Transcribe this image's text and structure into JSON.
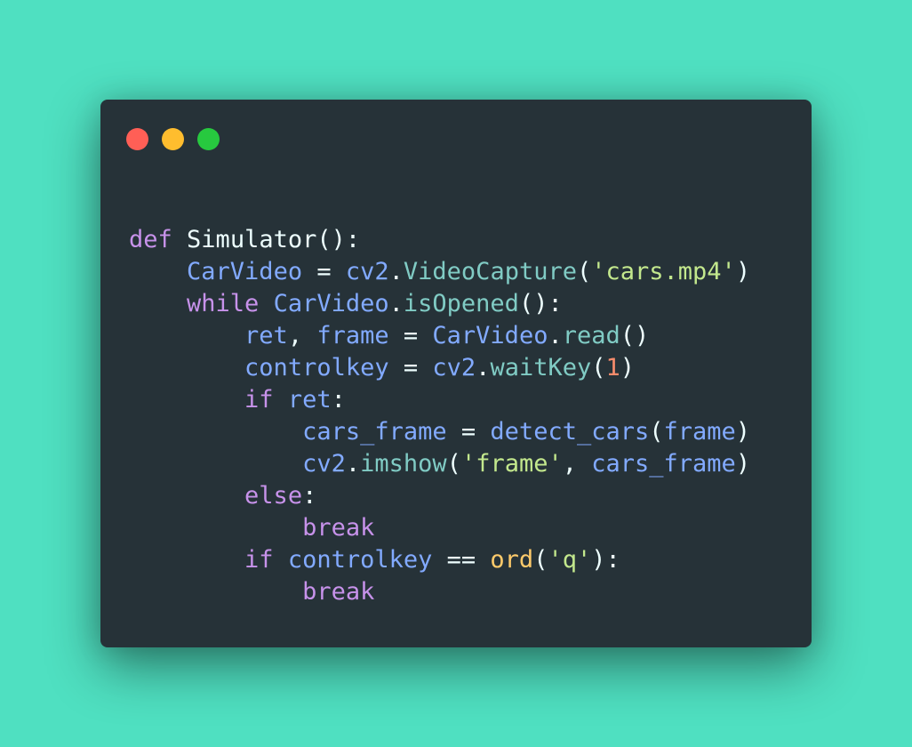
{
  "window_controls": [
    {
      "name": "close-dot",
      "color": "#ff5f56"
    },
    {
      "name": "minimize-dot",
      "color": "#ffbd2e"
    },
    {
      "name": "maximize-dot",
      "color": "#27c93f"
    }
  ],
  "code": {
    "language": "python",
    "lines": [
      {
        "indent": "",
        "tokens": [
          {
            "t": "def",
            "k": "keyword"
          },
          {
            "t": " ",
            "k": "plain"
          },
          {
            "t": "Simulator",
            "k": "plain"
          },
          {
            "t": "():",
            "k": "plain"
          }
        ]
      },
      {
        "indent": "    ",
        "tokens": [
          {
            "t": "CarVideo",
            "k": "variable"
          },
          {
            "t": " = ",
            "k": "plain"
          },
          {
            "t": "cv2",
            "k": "variable"
          },
          {
            "t": ".",
            "k": "plain"
          },
          {
            "t": "VideoCapture",
            "k": "method"
          },
          {
            "t": "(",
            "k": "plain"
          },
          {
            "t": "'cars.mp4'",
            "k": "string"
          },
          {
            "t": ")",
            "k": "plain"
          }
        ]
      },
      {
        "indent": "    ",
        "tokens": [
          {
            "t": "while",
            "k": "keyword"
          },
          {
            "t": " ",
            "k": "plain"
          },
          {
            "t": "CarVideo",
            "k": "variable"
          },
          {
            "t": ".",
            "k": "plain"
          },
          {
            "t": "isOpened",
            "k": "method"
          },
          {
            "t": "():",
            "k": "plain"
          }
        ]
      },
      {
        "indent": "        ",
        "tokens": [
          {
            "t": "ret",
            "k": "variable"
          },
          {
            "t": ", ",
            "k": "plain"
          },
          {
            "t": "frame",
            "k": "variable"
          },
          {
            "t": " = ",
            "k": "plain"
          },
          {
            "t": "CarVideo",
            "k": "variable"
          },
          {
            "t": ".",
            "k": "plain"
          },
          {
            "t": "read",
            "k": "method"
          },
          {
            "t": "()",
            "k": "plain"
          }
        ]
      },
      {
        "indent": "        ",
        "tokens": [
          {
            "t": "controlkey",
            "k": "variable"
          },
          {
            "t": " = ",
            "k": "plain"
          },
          {
            "t": "cv2",
            "k": "variable"
          },
          {
            "t": ".",
            "k": "plain"
          },
          {
            "t": "waitKey",
            "k": "method"
          },
          {
            "t": "(",
            "k": "plain"
          },
          {
            "t": "1",
            "k": "number"
          },
          {
            "t": ")",
            "k": "plain"
          }
        ]
      },
      {
        "indent": "        ",
        "tokens": [
          {
            "t": "if",
            "k": "keyword"
          },
          {
            "t": " ",
            "k": "plain"
          },
          {
            "t": "ret",
            "k": "variable"
          },
          {
            "t": ":",
            "k": "plain"
          }
        ]
      },
      {
        "indent": "            ",
        "tokens": [
          {
            "t": "cars_frame",
            "k": "variable"
          },
          {
            "t": " = ",
            "k": "plain"
          },
          {
            "t": "detect_cars",
            "k": "variable"
          },
          {
            "t": "(",
            "k": "plain"
          },
          {
            "t": "frame",
            "k": "variable"
          },
          {
            "t": ")",
            "k": "plain"
          }
        ]
      },
      {
        "indent": "            ",
        "tokens": [
          {
            "t": "cv2",
            "k": "variable"
          },
          {
            "t": ".",
            "k": "plain"
          },
          {
            "t": "imshow",
            "k": "method"
          },
          {
            "t": "(",
            "k": "plain"
          },
          {
            "t": "'frame'",
            "k": "string"
          },
          {
            "t": ", ",
            "k": "plain"
          },
          {
            "t": "cars_frame",
            "k": "variable"
          },
          {
            "t": ")",
            "k": "plain"
          }
        ]
      },
      {
        "indent": "        ",
        "tokens": [
          {
            "t": "else",
            "k": "keyword"
          },
          {
            "t": ":",
            "k": "plain"
          }
        ]
      },
      {
        "indent": "            ",
        "tokens": [
          {
            "t": "break",
            "k": "keyword"
          }
        ]
      },
      {
        "indent": "        ",
        "tokens": [
          {
            "t": "if",
            "k": "keyword"
          },
          {
            "t": " ",
            "k": "plain"
          },
          {
            "t": "controlkey",
            "k": "variable"
          },
          {
            "t": " == ",
            "k": "plain"
          },
          {
            "t": "ord",
            "k": "builtin"
          },
          {
            "t": "(",
            "k": "plain"
          },
          {
            "t": "'q'",
            "k": "string"
          },
          {
            "t": "):",
            "k": "plain"
          }
        ]
      },
      {
        "indent": "            ",
        "tokens": [
          {
            "t": "break",
            "k": "keyword"
          }
        ]
      }
    ]
  },
  "colors": {
    "background": "#4fe0c1",
    "window": "#263238",
    "keyword": "#c792ea",
    "variable": "#82aaff",
    "method": "#80cbc4",
    "string": "#c3e88d",
    "number": "#f78c6c",
    "builtin": "#ffcb6b",
    "plain": "#eeffff"
  }
}
